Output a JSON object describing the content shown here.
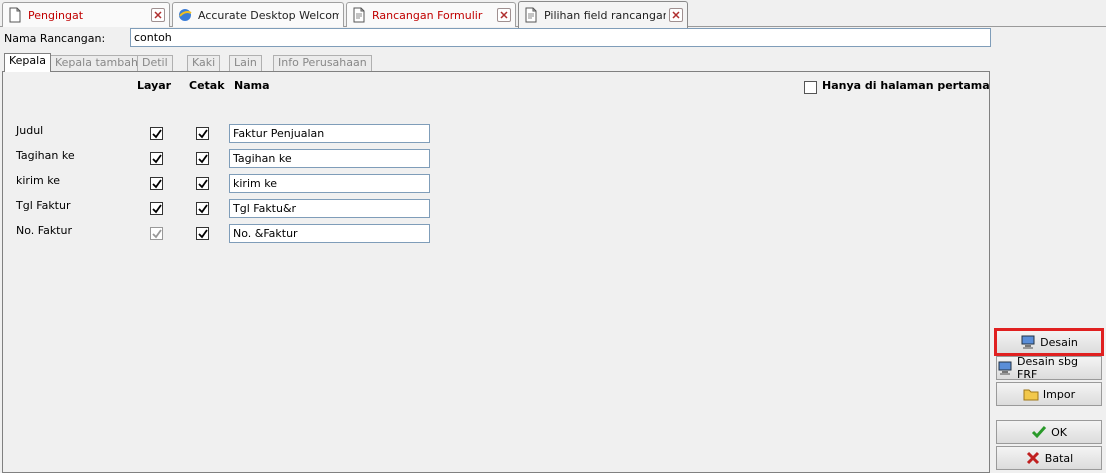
{
  "doc_tabs": [
    {
      "label": "Pengingat",
      "icon": "document-icon",
      "active": false
    },
    {
      "label": "Accurate Desktop Welcome...",
      "icon": "browser-icon",
      "active": false
    },
    {
      "label": "Rancangan Formulir",
      "icon": "document-icon",
      "active": false
    },
    {
      "label": "Pilihan field rancangan...",
      "icon": "document-icon",
      "active": true
    }
  ],
  "form": {
    "nama_label": "Nama Rancangan:",
    "nama_value": "contoh"
  },
  "section_tabs": [
    "Kepala",
    "Kepala tambahan",
    "Detil",
    "Kaki",
    "Lain",
    "Info Perusahaan"
  ],
  "active_section": "Kepala",
  "columns": {
    "layar": "Layar",
    "cetak": "Cetak",
    "nama": "Nama"
  },
  "hanya": {
    "label": "Hanya di halaman pertama",
    "checked": false
  },
  "rows": [
    {
      "label": "Judul",
      "layar": true,
      "cetak": true,
      "layar_disabled": false,
      "value": "Faktur Penjualan"
    },
    {
      "label": "Tagihan ke",
      "layar": true,
      "cetak": true,
      "layar_disabled": false,
      "value": "Tagihan ke"
    },
    {
      "label": "kirim ke",
      "layar": true,
      "cetak": true,
      "layar_disabled": false,
      "value": "kirim ke"
    },
    {
      "label": "Tgl Faktur",
      "layar": true,
      "cetak": true,
      "layar_disabled": false,
      "value": "Tgl Faktu&r"
    },
    {
      "label": "No. Faktur",
      "layar": true,
      "cetak": true,
      "layar_disabled": true,
      "value": "No. &Faktur"
    }
  ],
  "buttons": {
    "desain": "Desain",
    "desain_frf": "Desain sbg FRF",
    "impor": "Impor",
    "ok": "OK",
    "batal": "Batal"
  },
  "colors": {
    "highlight": "#e02020",
    "ok_green": "#2a9a2a",
    "batal_red": "#c02020",
    "close_red": "#c00000"
  }
}
